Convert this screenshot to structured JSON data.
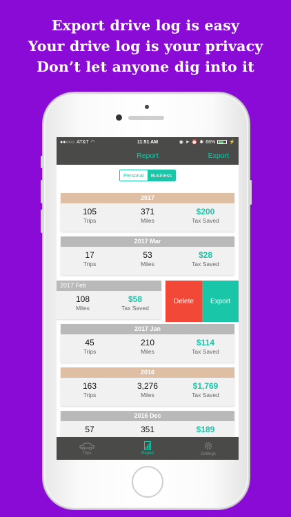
{
  "headline": {
    "line1": "Export drive log is easy",
    "line2": "Your drive log is your privacy",
    "line3": "Don’t let anyone dig into it"
  },
  "statusbar": {
    "carrier": "AT&T",
    "time": "11:51 AM",
    "battery": "66%"
  },
  "navbar": {
    "title": "Report",
    "export_label": "Export"
  },
  "segment": {
    "personal": "Personal",
    "business": "Business",
    "selected": "Business"
  },
  "cards": [
    {
      "period": "2017",
      "kind": "year",
      "trips": "105",
      "miles": "371",
      "tax": "$200",
      "trips_label": "Trips",
      "miles_label": "Miles",
      "tax_label": "Tax Saved"
    },
    {
      "period": "2017 Mar",
      "kind": "month",
      "trips": "17",
      "miles": "53",
      "tax": "$28",
      "trips_label": "Trips",
      "miles_label": "Miles",
      "tax_label": "Tax Saved"
    },
    {
      "period": "2017 Feb",
      "kind": "month",
      "miles": "108",
      "tax": "$58",
      "miles_label": "Miles",
      "tax_label": "Tax Saved",
      "delete_label": "Delete",
      "export_label": "Export"
    },
    {
      "period": "2017 Jan",
      "kind": "month",
      "trips": "45",
      "miles": "210",
      "tax": "$114",
      "trips_label": "Trips",
      "miles_label": "Miles",
      "tax_label": "Tax Saved"
    },
    {
      "period": "2016",
      "kind": "year",
      "trips": "163",
      "miles": "3,276",
      "tax": "$1,769",
      "trips_label": "Trips",
      "miles_label": "Miles",
      "tax_label": "Tax Saved"
    },
    {
      "period": "2016 Dec",
      "kind": "month",
      "trips": "57",
      "miles": "351",
      "tax": "$189"
    }
  ],
  "tabbar": [
    {
      "label": "Trips",
      "icon": "car-icon"
    },
    {
      "label": "Report",
      "icon": "report-icon",
      "active": true
    },
    {
      "label": "Settings",
      "icon": "gear-icon"
    }
  ],
  "colors": {
    "accent": "#19c6a8",
    "delete": "#f24838",
    "background": "#8a0ad6",
    "bar": "#4a4a48"
  }
}
